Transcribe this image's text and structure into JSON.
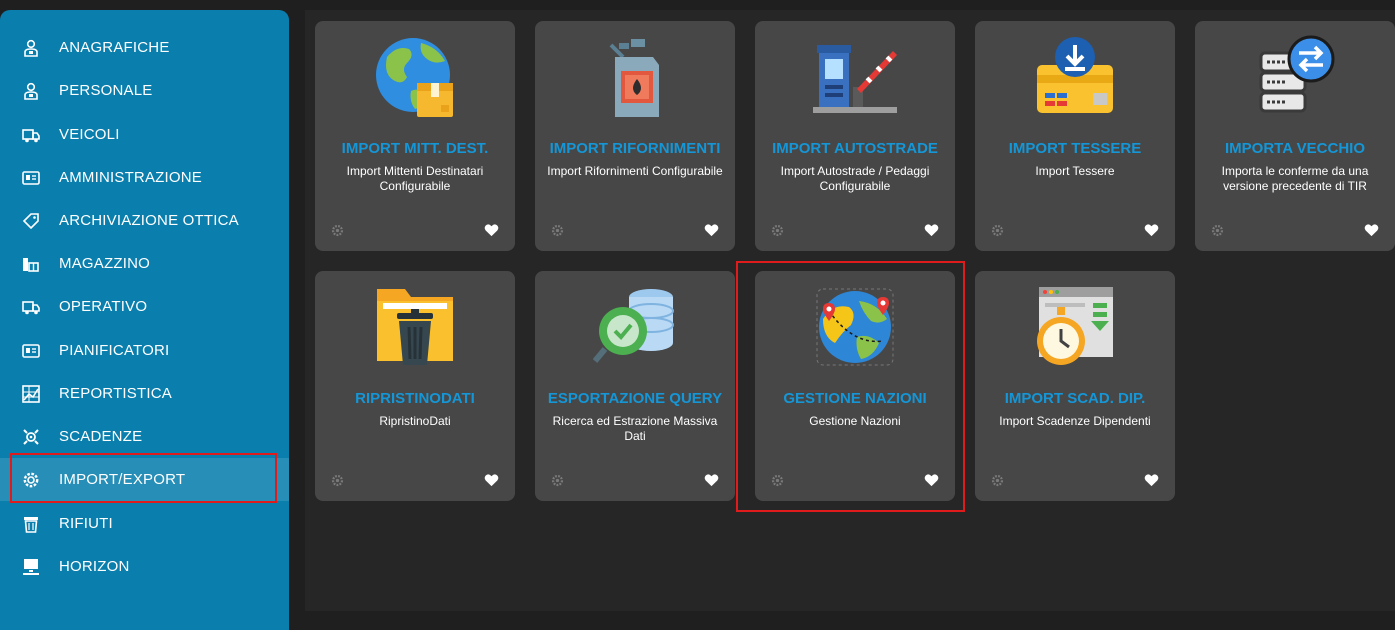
{
  "sidebar": {
    "items": [
      {
        "label": "ANAGRAFICHE",
        "icon": "person-badge-icon"
      },
      {
        "label": "PERSONALE",
        "icon": "person-badge-icon"
      },
      {
        "label": "VEICOLI",
        "icon": "truck-icon"
      },
      {
        "label": "AMMINISTRAZIONE",
        "icon": "id-card-icon"
      },
      {
        "label": "ARCHIVIAZIONE OTTICA",
        "icon": "tag-icon"
      },
      {
        "label": "MAGAZZINO",
        "icon": "warehouse-icon"
      },
      {
        "label": "OPERATIVO",
        "icon": "truck-icon"
      },
      {
        "label": "PIANIFICATORI",
        "icon": "id-card-icon"
      },
      {
        "label": "REPORTISTICA",
        "icon": "chart-grid-icon"
      },
      {
        "label": "SCADENZE",
        "icon": "gears-icon"
      },
      {
        "label": "IMPORT/EXPORT",
        "icon": "cog-icon",
        "active": true
      },
      {
        "label": "RIFIUTI",
        "icon": "trash-bin-icon"
      },
      {
        "label": "HORIZON",
        "icon": "monitor-icon"
      }
    ]
  },
  "cards": [
    {
      "title": "IMPORT MITT. DEST.",
      "desc": "Import Mittenti Destinatari Configurabile",
      "icon": "globe-box-icon"
    },
    {
      "title": "IMPORT RIFORNIMENTI",
      "desc": "Import Rifornimenti Configurabile",
      "icon": "fuel-can-icon"
    },
    {
      "title": "IMPORT AUTOSTRADE",
      "desc": "Import Autostrade / Pedaggi Configurabile",
      "icon": "toll-booth-icon"
    },
    {
      "title": "IMPORT TESSERE",
      "desc": "Import Tessere",
      "icon": "card-download-icon"
    },
    {
      "title": "IMPORTA VECCHIO",
      "desc": "Importa le conferme da una versione precedente di TIR",
      "icon": "server-sync-icon"
    },
    {
      "title": "RIPRISTINODATI",
      "desc": "RipristinoDati",
      "icon": "folder-trash-icon"
    },
    {
      "title": "ESPORTAZIONE QUERY",
      "desc": "Ricerca ed Estrazione Massiva Dati",
      "icon": "database-search-icon"
    },
    {
      "title": "GESTIONE NAZIONI",
      "desc": "Gestione Nazioni",
      "icon": "world-map-icon"
    },
    {
      "title": "IMPORT SCAD. DIP.",
      "desc": "Import Scadenze Dipendenti",
      "icon": "stopwatch-download-icon"
    }
  ],
  "colors": {
    "sidebar": "#0a7fae",
    "accent_title": "#1596d6",
    "card_bg": "#474747",
    "highlight": "#e01b1b"
  }
}
